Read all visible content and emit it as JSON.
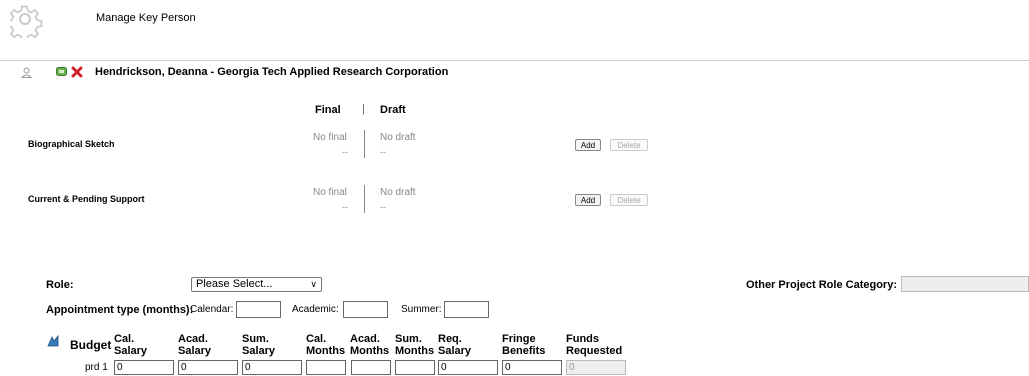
{
  "header": {
    "title": "Manage Key Person"
  },
  "person": {
    "name": "Hendrickson, Deanna - Georgia Tech Applied Research Corporation"
  },
  "columns": {
    "final": "Final",
    "separator": "|",
    "draft": "Draft"
  },
  "documents": [
    {
      "label": "Biographical Sketch",
      "final_status": "No final",
      "final_sub": "--",
      "draft_status": "No draft",
      "draft_sub": "--",
      "add": "Add",
      "delete": "Delete"
    },
    {
      "label": "Current & Pending Support",
      "final_status": "No final",
      "final_sub": "--",
      "draft_status": "No draft",
      "draft_sub": "--",
      "add": "Add",
      "delete": "Delete"
    }
  ],
  "role": {
    "label": "Role:",
    "selected": "Please Select...",
    "other_label": "Other Project Role Category:"
  },
  "appointment": {
    "label": "Appointment type (months):",
    "calendar": "Calendar:",
    "academic": "Academic:",
    "summer": "Summer:"
  },
  "budget": {
    "label": "Budget",
    "headers": [
      {
        "l1": "Cal.",
        "l2": "Salary"
      },
      {
        "l1": "Acad.",
        "l2": "Salary"
      },
      {
        "l1": "Sum.",
        "l2": "Salary"
      },
      {
        "l1": "Cal.",
        "l2": "Months"
      },
      {
        "l1": "Acad.",
        "l2": "Months"
      },
      {
        "l1": "Sum.",
        "l2": "Months"
      },
      {
        "l1": "Req.",
        "l2": "Salary"
      },
      {
        "l1": "Fringe",
        "l2": "Benefits"
      },
      {
        "l1": "Funds",
        "l2": "Requested"
      }
    ],
    "rows": [
      {
        "period": "prd 1",
        "values": [
          "0",
          "0",
          "0",
          "",
          "",
          "",
          "0",
          "0",
          "0"
        ]
      }
    ]
  },
  "icons": [
    "gear-icon",
    "person-icon",
    "edit-icon",
    "delete-icon",
    "budget-calculator-icon",
    "chevron-down-icon"
  ]
}
